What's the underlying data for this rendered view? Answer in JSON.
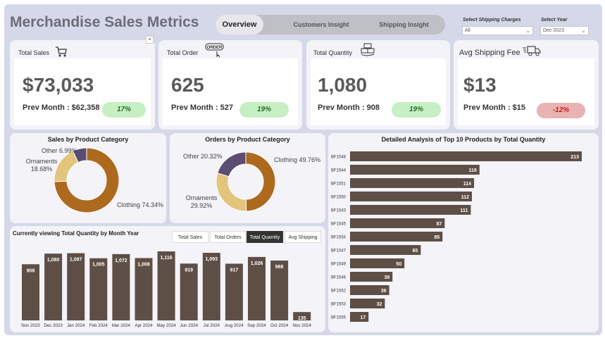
{
  "title": "Merchandise Sales Metrics",
  "nav": {
    "tabs": [
      "Overview",
      "Customers Insight",
      "Shipping Insight"
    ],
    "active": "Overview"
  },
  "filters": {
    "shipping": {
      "label": "Select Shipping Charges",
      "value": "All"
    },
    "year": {
      "label": "Select Year",
      "value": "Dec 2023"
    }
  },
  "kpis": [
    {
      "label": "Total Sales",
      "value": "$73,033",
      "prev": "Prev Month : $62,358",
      "delta": "17%",
      "direction": "up",
      "icon": "shopping-cart-icon"
    },
    {
      "label": "Total Order",
      "value": "625",
      "prev": "Prev Month : 527",
      "delta": "19%",
      "direction": "up",
      "icon": "order-icon"
    },
    {
      "label": "Total Quantity",
      "value": "1,080",
      "prev": "Prev Month : 908",
      "delta": "19%",
      "direction": "up",
      "icon": "stacked-boxes-icon"
    },
    {
      "label": "Avg Shipping Fee",
      "value": "$13",
      "prev": "Prev Month : $15",
      "delta": "-12%",
      "direction": "down",
      "icon": "delivery-truck-icon"
    }
  ],
  "colors": {
    "clothing": "#ad6a1e",
    "ornaments": "#e2c47d",
    "other": "#5b4d72",
    "bar": "#5e4f46",
    "up_bg": "#c7efc4",
    "down_bg": "#e9b2b3"
  },
  "chart_data": [
    {
      "type": "pie",
      "title": "Sales by Product Category",
      "labels": [
        "Clothing",
        "Ornaments",
        "Other"
      ],
      "values": [
        74.34,
        18.68,
        6.99
      ],
      "display": [
        "Clothing 74.34%",
        "Ornaments 18.68%",
        "Other 6.99%"
      ]
    },
    {
      "type": "pie",
      "title": "Orders by Product Category",
      "labels": [
        "Clothing",
        "Ornaments",
        "Other"
      ],
      "values": [
        49.76,
        29.92,
        20.32
      ],
      "display": [
        "Clothing 49.76%",
        "Ornaments 29.92%",
        "Other 20.32%"
      ]
    },
    {
      "type": "bar",
      "orientation": "vertical",
      "title": "Currently viewing Total Quantity by Month Year",
      "categories": [
        "Nov 2023",
        "Dec 2023",
        "Jan 2024",
        "Feb 2024",
        "Mar 2024",
        "Apr 2024",
        "May 2024",
        "Jun 2024",
        "Jul 2024",
        "Aug 2024",
        "Sep 2024",
        "Oct 2024",
        "Nov 2024"
      ],
      "values": [
        908,
        1080,
        1087,
        1005,
        1072,
        1008,
        1116,
        919,
        1093,
        917,
        1026,
        968,
        135
      ],
      "value_labels": [
        "908",
        "1,080",
        "1,087",
        "1,005",
        "1,072",
        "1,008",
        "1,116",
        "919",
        "1,093",
        "917",
        "1,026",
        "968",
        "135"
      ],
      "tabs": [
        "Total Sales",
        "Total Orders",
        "Total Quantity",
        "Avg Shipping"
      ],
      "active_tab": "Total Quantity"
    },
    {
      "type": "bar",
      "orientation": "horizontal",
      "title": "Detailed Analysis of Top 10 Products by Total Quantity",
      "categories": [
        "BF1548",
        "BF1544",
        "BF1551",
        "BF1550",
        "BF1543",
        "BF1545",
        "BF1554",
        "BF1547",
        "BF1549",
        "BF1546",
        "BF1552",
        "BF1553",
        "BF1555"
      ],
      "values": [
        213,
        119,
        114,
        112,
        111,
        87,
        85,
        65,
        50,
        39,
        36,
        32,
        17
      ]
    }
  ]
}
